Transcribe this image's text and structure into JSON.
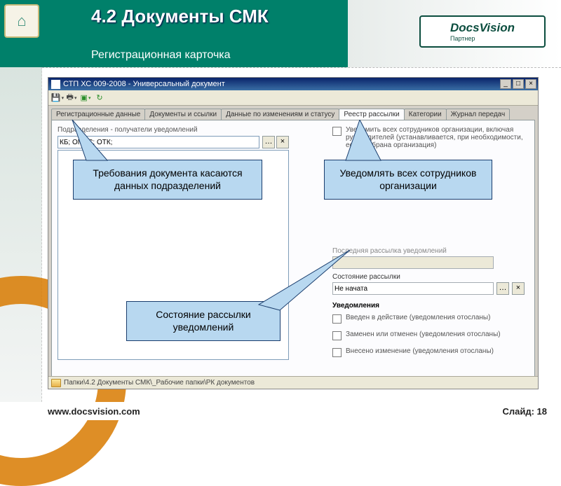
{
  "slide": {
    "section_title": "4.2 Документы СМК",
    "subtitle": "Регистрационная карточка",
    "logo_left": "⌂",
    "logo_right": "DocsVision",
    "logo_right_sub": "Партнер",
    "footer_url": "www.docsvision.com",
    "footer_slide": "Слайд: 18"
  },
  "window": {
    "title": "СТП ХС 009-2008 - Универсальный документ",
    "min": "_",
    "max": "□",
    "close": "×",
    "path": "Папки\\4.2   Документы СМК\\_Рабочие папки\\РК документов"
  },
  "tabs": [
    "Регистрационные данные",
    "Документы и ссылки",
    "Данные по изменениям и статусу",
    "Реестр рассылки",
    "Категории",
    "Журнал передач"
  ],
  "form": {
    "departments_label": "Подразделения - получатели уведомлений",
    "departments_value": "КБ; ОМТС; ОТК;",
    "dots_btn": "…",
    "x_btn": "×",
    "notify_all": "Уведомить всех сотрудников организации, включая руководителей (устанавливается, при необходимости, если выбрана организация)",
    "last_send_label": "Последняя рассылка уведомлений",
    "last_send_value": "",
    "state_label": "Состояние рассылки",
    "state_value": "Не начата",
    "notif_header": "Уведомления",
    "notif1": "Введен в действие (уведомления отосланы)",
    "notif2": "Заменен или отменен (уведомления отосланы)",
    "notif3": "Внесено изменение (уведомления отосланы)"
  },
  "callouts": {
    "c1": "Требования документа касаются данных подразделений",
    "c2": "Уведомлять всех сотрудников организации",
    "c3": "Состояние рассылки уведомлений"
  }
}
